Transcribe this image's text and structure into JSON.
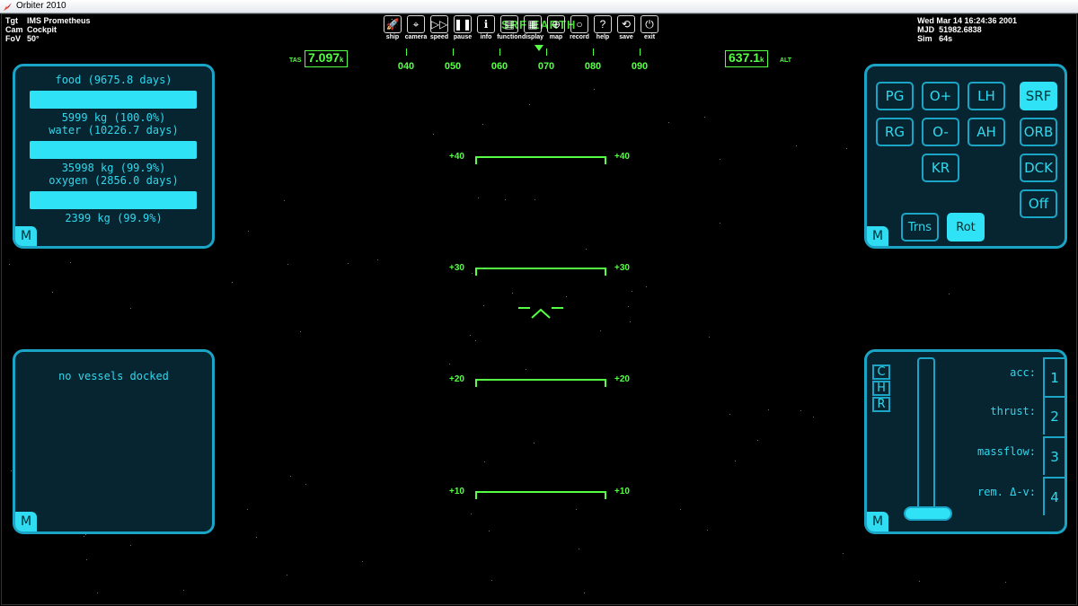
{
  "window": {
    "title": "Orbiter 2010"
  },
  "info_left": {
    "rows": [
      {
        "k": "Tgt",
        "v": "IMS Prometheus"
      },
      {
        "k": "Cam",
        "v": "Cockpit"
      },
      {
        "k": "FoV",
        "v": "50°"
      }
    ]
  },
  "info_right": {
    "datetime": "Wed Mar 14 16:24:36 2001",
    "rows": [
      {
        "k": "MJD",
        "v": "51982.6838"
      },
      {
        "k": "Sim",
        "v": "64s"
      }
    ]
  },
  "toolbar": {
    "items": [
      {
        "label": "ship",
        "icon": "rocket-icon",
        "glyph": "🚀"
      },
      {
        "label": "camera",
        "icon": "camera-icon",
        "glyph": "⌖"
      },
      {
        "label": "speed",
        "icon": "fast-forward-icon",
        "glyph": "▷▷"
      },
      {
        "label": "pause",
        "icon": "pause-icon",
        "glyph": "❚❚"
      },
      {
        "label": "info",
        "icon": "info-icon",
        "glyph": "ℹ"
      },
      {
        "label": "function",
        "icon": "function-icon",
        "glyph": "▤"
      },
      {
        "label": "display",
        "icon": "display-icon",
        "glyph": "▦"
      },
      {
        "label": "map",
        "icon": "globe-icon",
        "glyph": "⊕"
      },
      {
        "label": "record",
        "icon": "record-icon",
        "glyph": "○"
      },
      {
        "label": "help",
        "icon": "help-icon",
        "glyph": "?"
      },
      {
        "label": "save",
        "icon": "save-icon",
        "glyph": "⟲"
      },
      {
        "label": "exit",
        "icon": "power-icon",
        "glyph": "⏻"
      }
    ]
  },
  "hud": {
    "mode": "SRF EARTH",
    "heading_labels": [
      "040",
      "050",
      "060",
      "070",
      "080",
      "090"
    ],
    "tas_label": "TAS",
    "tas_value": "7.097",
    "tas_unit": "k",
    "alt_value": "637.1",
    "alt_unit": "k",
    "alt_label": "ALT",
    "pitch": [
      {
        "left": "+40",
        "right": "+40"
      },
      {
        "left": "+30",
        "right": "+30"
      },
      {
        "left": "+20",
        "right": "+20"
      },
      {
        "left": "+10",
        "right": "+10"
      }
    ]
  },
  "consumables": {
    "items": [
      {
        "title": "food (9675.8 days)",
        "mass": "5999 kg (100.0%)",
        "level": 1.0
      },
      {
        "title": "water (10226.7 days)",
        "mass": "35998 kg (99.9%)",
        "level": 0.999
      },
      {
        "title": "oxygen (2856.0 days)",
        "mass": "2399 kg (99.9%)",
        "level": 0.999
      }
    ],
    "m_label": "M"
  },
  "docking": {
    "text": "no vessels docked",
    "m_label": "M"
  },
  "autopilot": {
    "buttons": {
      "pg": "PG",
      "oplus": "O+",
      "lh": "LH",
      "srf": "SRF",
      "rg": "RG",
      "ominus": "O-",
      "ah": "AH",
      "orb": "ORB",
      "kr": "KR",
      "dck": "DCK",
      "off": "Off",
      "trns": "Trns",
      "rot": "Rot"
    },
    "m_label": "M"
  },
  "engines": {
    "mode_letters": [
      "C",
      "H",
      "R"
    ],
    "labels": [
      "acc:",
      "thrust:",
      "massflow:",
      "rem. Δ-v:"
    ],
    "groups": [
      "1",
      "2",
      "3",
      "4"
    ],
    "throttle_level": 0.0,
    "m_label": "M"
  }
}
